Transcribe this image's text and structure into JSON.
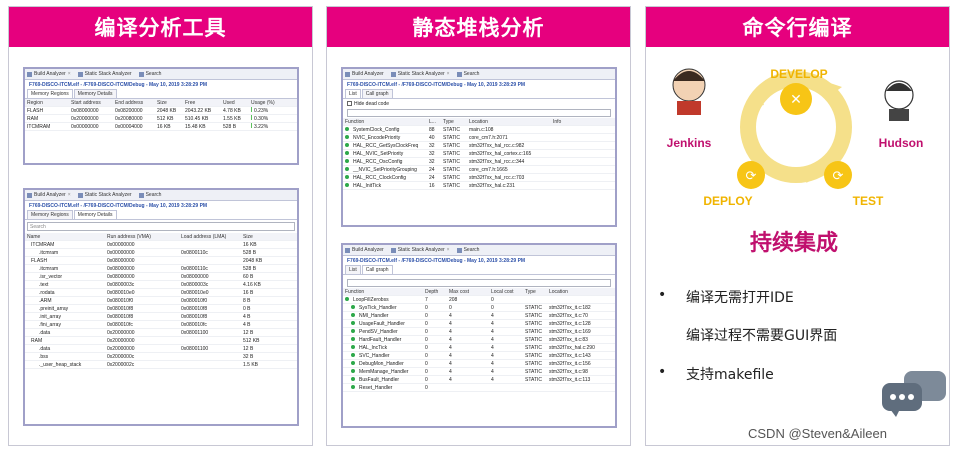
{
  "panels": [
    {
      "title": "编译分析工具"
    },
    {
      "title": "静态堆栈分析"
    },
    {
      "title": "命令行编译"
    }
  ],
  "tabs": {
    "build": "Build Analyzer",
    "static": "Static Stack Analyzer",
    "search": "Search"
  },
  "path": "F769-DISCO-ITCM.elf - /F769-DISCO-ITCM/Debug - May 10, 2019 3:28:29 PM",
  "mem": {
    "subtabs": [
      "Memory Regions",
      "Memory Details"
    ],
    "headers": [
      "Region",
      "Start address",
      "End address",
      "Size",
      "Free",
      "Used",
      "Usage (%)"
    ],
    "rows": [
      {
        "name": "FLASH",
        "start": "0x08000000",
        "end": "0x08200000",
        "size": "2048 KB",
        "free": "2043.22 KB",
        "used": "4.78 KB",
        "usage": "0.23%",
        "pct": 0.23
      },
      {
        "name": "RAM",
        "start": "0x20000000",
        "end": "0x20080000",
        "size": "512 KB",
        "free": "510.45 KB",
        "used": "1.55 KB",
        "usage": "0.30%",
        "pct": 0.3
      },
      {
        "name": "ITCMRAM",
        "start": "0x00000000",
        "end": "0x00004000",
        "size": "16 KB",
        "free": "15.48 KB",
        "used": "528 B",
        "usage": "3.22%",
        "pct": 3.22
      }
    ]
  },
  "details": {
    "search": "Search",
    "headers": [
      "Name",
      "Run address (VMA)",
      "Load address (LMA)",
      "Size"
    ],
    "rows": [
      {
        "n": "ITCMRAM",
        "r": "0x00000000",
        "l": "",
        "s": "16 KB",
        "lvl": 0
      },
      {
        "n": ".itcmram",
        "r": "0x00000000",
        "l": "0x0800110c",
        "s": "528 B",
        "lvl": 1
      },
      {
        "n": "FLASH",
        "r": "0x08000000",
        "l": "",
        "s": "2048 KB",
        "lvl": 0
      },
      {
        "n": ".itcmram",
        "r": "0x08000000",
        "l": "0x0800110c",
        "s": "528 B",
        "lvl": 1
      },
      {
        "n": ".isr_vector",
        "r": "0x08000000",
        "l": "0x08000000",
        "s": "60 B",
        "lvl": 1
      },
      {
        "n": ".text",
        "r": "0x0800003c",
        "l": "0x0800003c",
        "s": "4.16 KB",
        "lvl": 1
      },
      {
        "n": ".rodata",
        "r": "0x080010e0",
        "l": "0x080010e0",
        "s": "16 B",
        "lvl": 1
      },
      {
        "n": ".ARM",
        "r": "0x080010f0",
        "l": "0x080010f0",
        "s": "8 B",
        "lvl": 1
      },
      {
        "n": ".preinit_array",
        "r": "0x080010f8",
        "l": "0x080010f8",
        "s": "0 B",
        "lvl": 1
      },
      {
        "n": ".init_array",
        "r": "0x080010f8",
        "l": "0x080010f8",
        "s": "4 B",
        "lvl": 1
      },
      {
        "n": ".fini_array",
        "r": "0x080010fc",
        "l": "0x080010fc",
        "s": "4 B",
        "lvl": 1
      },
      {
        "n": ".data",
        "r": "0x20000000",
        "l": "0x08001100",
        "s": "12 B",
        "lvl": 1
      },
      {
        "n": "RAM",
        "r": "0x20000000",
        "l": "",
        "s": "512 KB",
        "lvl": 0
      },
      {
        "n": ".data",
        "r": "0x20000000",
        "l": "0x08001100",
        "s": "12 B",
        "lvl": 1
      },
      {
        "n": ".bss",
        "r": "0x2000000c",
        "l": "",
        "s": "32 B",
        "lvl": 1
      },
      {
        "n": "._user_heap_stack",
        "r": "0x2000002c",
        "l": "",
        "s": "1.5 KB",
        "lvl": 1
      }
    ]
  },
  "list": {
    "subtabs": [
      "List",
      "Call graph"
    ],
    "hide": "Hide dead code",
    "headers": [
      "Function",
      "L...",
      "Type",
      "Location",
      "Info"
    ],
    "rows": [
      {
        "f": "SystemClock_Config",
        "l": "88",
        "t": "STATIC",
        "loc": "main.c:108"
      },
      {
        "f": "NVIC_EncodePriority",
        "l": "40",
        "t": "STATIC",
        "loc": "core_cm7.h:2071"
      },
      {
        "f": "HAL_RCC_GetSysClockFreq",
        "l": "32",
        "t": "STATIC",
        "loc": "stm32f7xx_hal_rcc.c:982"
      },
      {
        "f": "HAL_NVIC_SetPriority",
        "l": "32",
        "t": "STATIC",
        "loc": "stm32f7xx_hal_cortex.c:165"
      },
      {
        "f": "HAL_RCC_OscConfig",
        "l": "32",
        "t": "STATIC",
        "loc": "stm32f7xx_hal_rcc.c:344"
      },
      {
        "f": "__NVIC_SetPriorityGrouping",
        "l": "24",
        "t": "STATIC",
        "loc": "core_cm7.h:1665"
      },
      {
        "f": "HAL_RCC_ClockConfig",
        "l": "24",
        "t": "STATIC",
        "loc": "stm32f7xx_hal_rcc.c:703"
      },
      {
        "f": "HAL_InitTick",
        "l": "16",
        "t": "STATIC",
        "loc": "stm32f7xx_hal.c:231"
      }
    ]
  },
  "callgraph": {
    "subtabs": [
      "List",
      "Call graph"
    ],
    "headers": [
      "Function",
      "Depth",
      "Max cost",
      "Local cost",
      "Type",
      "Location"
    ],
    "rows": [
      {
        "f": "LoopFillZerobss",
        "d": "7",
        "m": "208",
        "c": "0",
        "t": "",
        "loc": ""
      },
      {
        "f": "SysTick_Handler",
        "d": "0",
        "m": "0",
        "c": "0",
        "t": "STATIC",
        "loc": "stm32f7xx_it.c:182"
      },
      {
        "f": "NMI_Handler",
        "d": "0",
        "m": "4",
        "c": "4",
        "t": "STATIC",
        "loc": "stm32f7xx_it.c:70"
      },
      {
        "f": "UsageFault_Handler",
        "d": "0",
        "m": "4",
        "c": "4",
        "t": "STATIC",
        "loc": "stm32f7xx_it.c:128"
      },
      {
        "f": "PendSV_Handler",
        "d": "0",
        "m": "4",
        "c": "4",
        "t": "STATIC",
        "loc": "stm32f7xx_it.c:169"
      },
      {
        "f": "HardFault_Handler",
        "d": "0",
        "m": "4",
        "c": "4",
        "t": "STATIC",
        "loc": "stm32f7xx_it.c:83"
      },
      {
        "f": "HAL_IncTick",
        "d": "0",
        "m": "4",
        "c": "4",
        "t": "STATIC",
        "loc": "stm32f7xx_hal.c:290"
      },
      {
        "f": "SVC_Handler",
        "d": "0",
        "m": "4",
        "c": "4",
        "t": "STATIC",
        "loc": "stm32f7xx_it.c:143"
      },
      {
        "f": "DebugMon_Handler",
        "d": "0",
        "m": "4",
        "c": "4",
        "t": "STATIC",
        "loc": "stm32f7xx_it.c:156"
      },
      {
        "f": "MemManage_Handler",
        "d": "0",
        "m": "4",
        "c": "4",
        "t": "STATIC",
        "loc": "stm32f7xx_it.c:98"
      },
      {
        "f": "BusFault_Handler",
        "d": "0",
        "m": "4",
        "c": "4",
        "t": "STATIC",
        "loc": "stm32f7xx_it.c:113"
      },
      {
        "f": "Reset_Handler",
        "d": "0",
        "m": "",
        "c": "",
        "t": "",
        "loc": ""
      }
    ]
  },
  "ci": {
    "develop": "DEVELOP",
    "test": "TEST",
    "deploy": "DEPLOY",
    "jenkins": "Jenkins",
    "hudson": "Hudson",
    "caption": "持续集成",
    "bullets": [
      "编译无需打开IDE",
      "编译过程不需要GUI界面",
      "支持makefile"
    ]
  },
  "watermark": "CSDN @Steven&Aileen",
  "colors": {
    "header": "#e6007e",
    "arrow": "#f5e08a",
    "circle": "#f7c516",
    "caption": "#c0106e"
  }
}
